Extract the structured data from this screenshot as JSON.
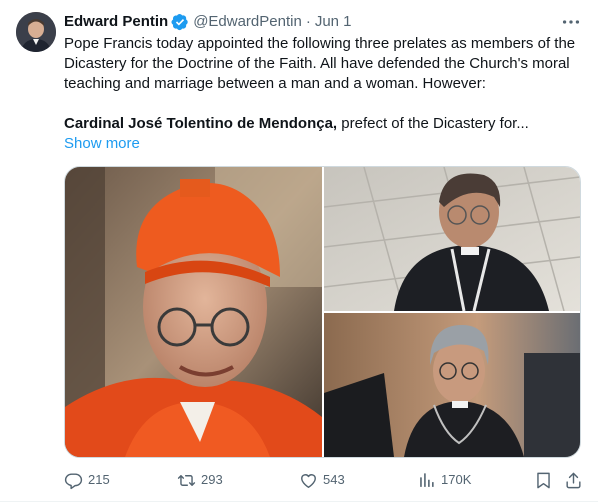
{
  "tweet": {
    "author_name": "Edward Pentin",
    "handle": "@EdwardPentin",
    "separator": "·",
    "date": "Jun 1",
    "paragraph1": "Pope Francis today appointed the following three prelates as members of the Dicastery for the Doctrine of the Faith. All have defended the Church's moral teaching and marriage between a man and a woman. However:",
    "paragraph2_bold": "Cardinal José Tolentino de Mendonça,",
    "paragraph2_rest": " prefect of the Dicastery for...",
    "show_more": "Show more"
  },
  "icons": {
    "verified": "verified-badge-icon",
    "more": "more-icon",
    "reply": "reply-icon",
    "retweet": "retweet-icon",
    "like": "like-icon",
    "views": "views-icon",
    "bookmark": "bookmark-icon",
    "share": "share-icon"
  },
  "actions": {
    "replies": "215",
    "retweets": "293",
    "likes": "543",
    "views": "170K"
  },
  "colors": {
    "text": "#0f1419",
    "secondary": "#536471",
    "link": "#1d9bf0",
    "verified": "#1d9bf0"
  }
}
